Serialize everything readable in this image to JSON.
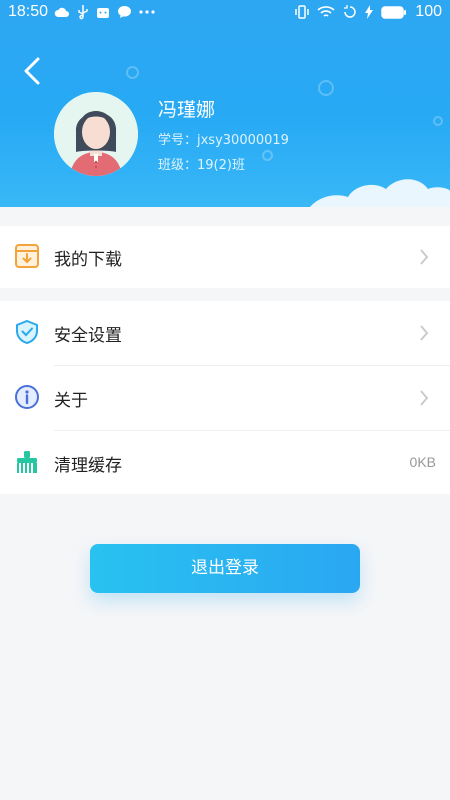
{
  "status_bar": {
    "time": "18:50",
    "battery": "100",
    "left_icons": [
      "cloud-icon",
      "usb-icon",
      "android-icon",
      "chat-icon",
      "more-icon"
    ],
    "right_icons": [
      "vibrate-icon",
      "wifi-icon",
      "rotate-icon",
      "charging-icon",
      "battery-icon"
    ]
  },
  "profile": {
    "name": "冯瑾娜",
    "student_id": "学号：jxsy30000019",
    "class": "班级：19(2)班"
  },
  "menu": {
    "downloads": {
      "label": "我的下载",
      "icon": "download-box-icon"
    },
    "security": {
      "label": "安全设置",
      "icon": "shield-check-icon"
    },
    "about": {
      "label": "关于",
      "icon": "info-icon"
    },
    "cache": {
      "label": "清理缓存",
      "value": "0KB",
      "icon": "broom-icon"
    }
  },
  "logout_label": "退出登录",
  "colors": {
    "header": "#2ea7f2",
    "accent_button": "#2aa7f2",
    "background": "#f5f6f8"
  }
}
